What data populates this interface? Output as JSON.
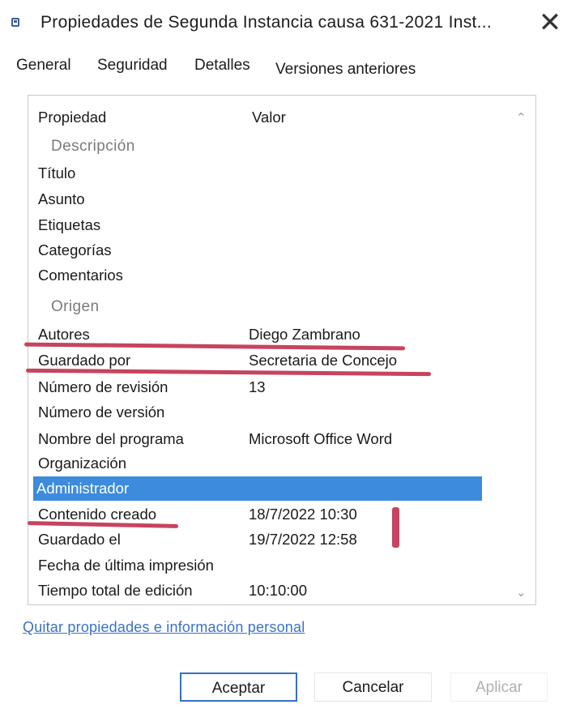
{
  "window": {
    "title": "Propiedades de Segunda Instancia causa 631-2021 Inst...",
    "close_glyph": "✕"
  },
  "tabs": [
    "General",
    "Seguridad",
    "Detalles",
    "Versiones anteriores"
  ],
  "table": {
    "header": {
      "label": "Propiedad",
      "value": "Valor"
    },
    "rows": [
      {
        "label": "Descripción",
        "value": "",
        "section": true
      },
      {
        "label": "Título",
        "value": ""
      },
      {
        "label": "Asunto",
        "value": ""
      },
      {
        "label": "Etiquetas",
        "value": ""
      },
      {
        "label": "Categorías",
        "value": ""
      },
      {
        "label": "Comentarios",
        "value": ""
      },
      {
        "label": "Origen",
        "value": "",
        "section": true
      },
      {
        "label": "Autores",
        "value": "Diego Zambrano"
      },
      {
        "label": "Guardado por",
        "value": "Secretaria de Concejo"
      },
      {
        "label": "Número de revisión",
        "value": "13"
      },
      {
        "label": "Número de versión",
        "value": ""
      },
      {
        "label": "Nombre del programa",
        "value": "Microsoft Office Word"
      },
      {
        "label": "Organización",
        "value": ""
      },
      {
        "label": "Administrador",
        "value": "",
        "selected": true
      },
      {
        "label": "Contenido creado",
        "value": "18/7/2022 10:30"
      },
      {
        "label": "Guardado el",
        "value": "19/7/2022 12:58"
      },
      {
        "label": "Fecha de última impresión",
        "value": ""
      },
      {
        "label": "Tiempo total de edición",
        "value": "10:10:00"
      }
    ]
  },
  "scroll": {
    "up_glyph": "⌃",
    "down_glyph": "⌄"
  },
  "remove_link": "Quitar propiedades e información personal",
  "buttons": {
    "ok": "Aceptar",
    "cancel": "Cancelar",
    "apply": "Aplicar"
  },
  "colors": {
    "selection": "#3c8bdc",
    "annotation": "#c64461",
    "link": "#3a72c7",
    "default_button_border": "#3470c6"
  }
}
